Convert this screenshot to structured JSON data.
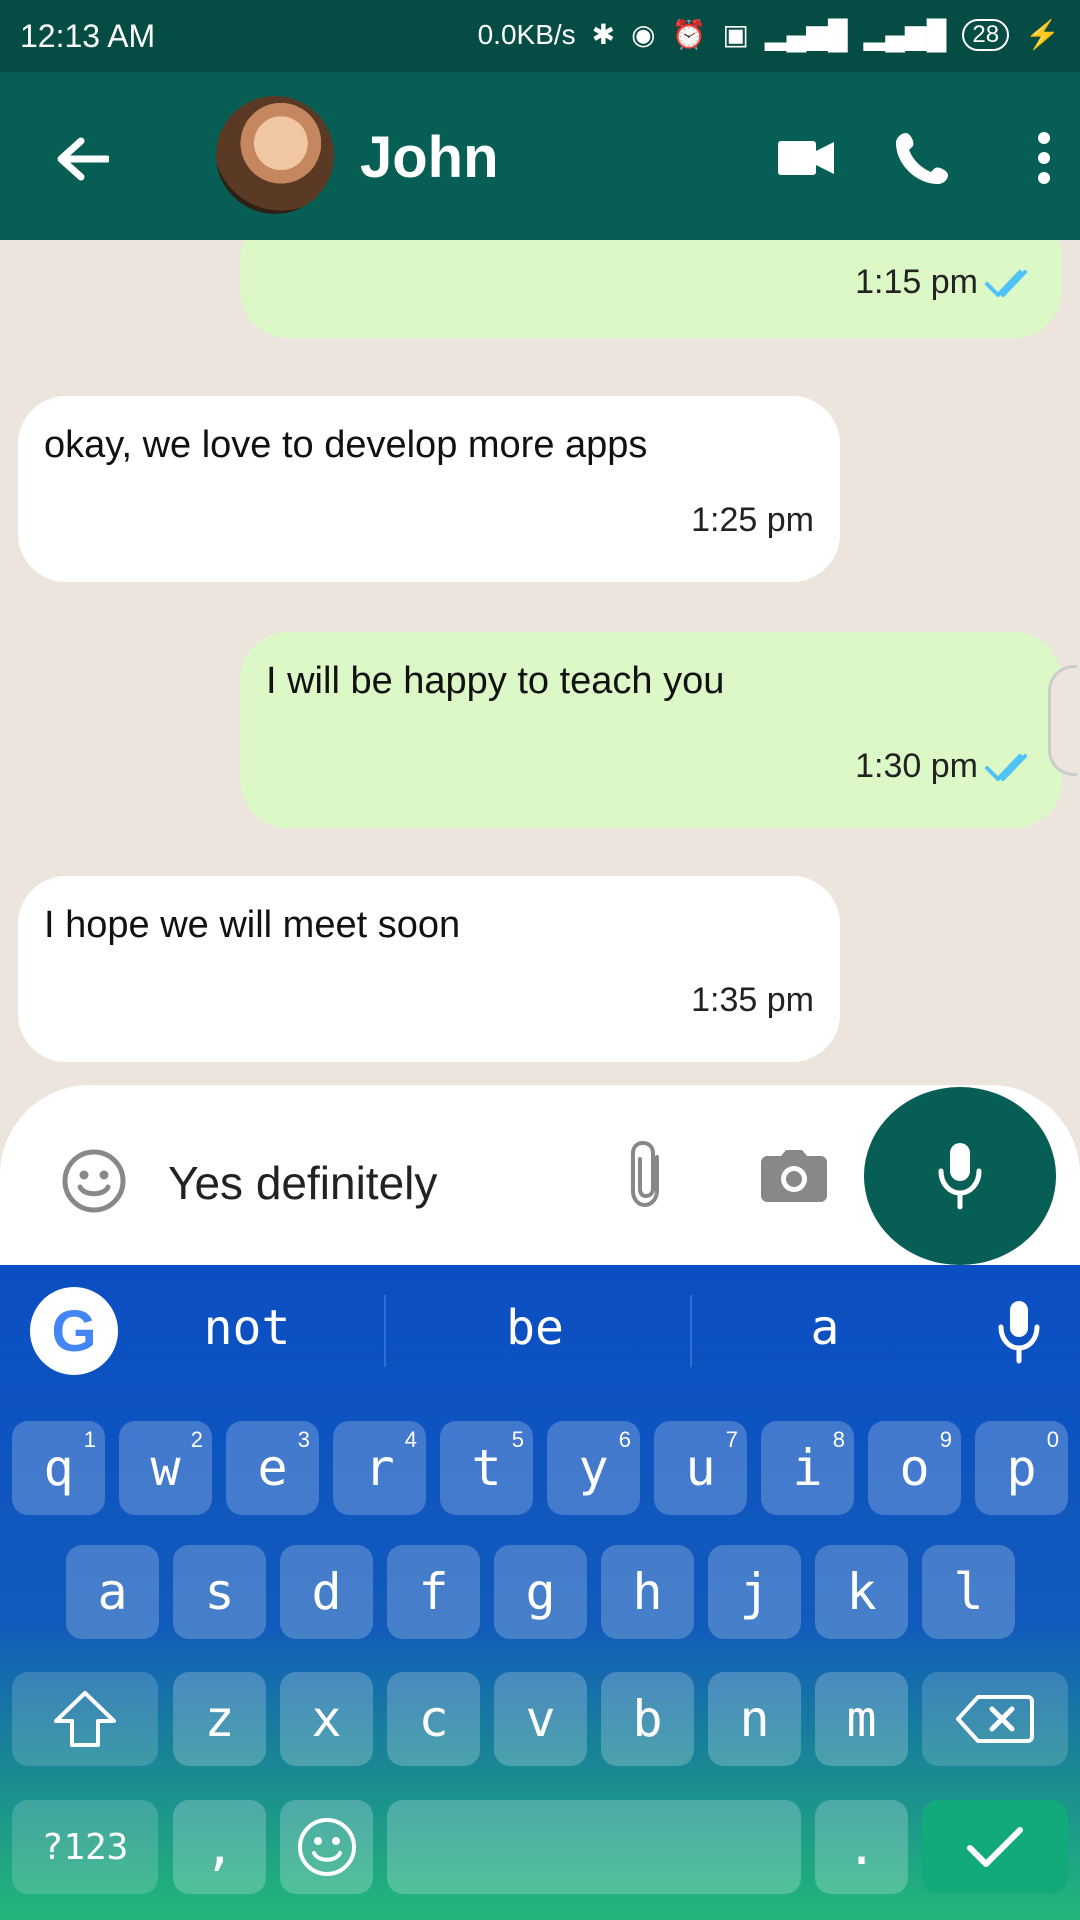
{
  "status_bar": {
    "time": "12:13 AM",
    "data_speed": "0.0KB/s",
    "battery": "28"
  },
  "header": {
    "contact_name": "John"
  },
  "messages": [
    {
      "direction": "outgoing",
      "text": "",
      "time": "1:15 pm"
    },
    {
      "direction": "incoming",
      "text": "okay, we love to develop more apps",
      "time": "1:25 pm"
    },
    {
      "direction": "outgoing",
      "text": "I will be happy to teach you",
      "time": "1:30 pm"
    },
    {
      "direction": "incoming",
      "text": "I hope we will meet soon",
      "time": "1:35 pm"
    }
  ],
  "composer": {
    "value": "Yes definitely"
  },
  "keyboard": {
    "suggestions": [
      "not",
      "be",
      "a"
    ],
    "row1": [
      {
        "key": "q",
        "num": "1"
      },
      {
        "key": "w",
        "num": "2"
      },
      {
        "key": "e",
        "num": "3"
      },
      {
        "key": "r",
        "num": "4"
      },
      {
        "key": "t",
        "num": "5"
      },
      {
        "key": "y",
        "num": "6"
      },
      {
        "key": "u",
        "num": "7"
      },
      {
        "key": "i",
        "num": "8"
      },
      {
        "key": "o",
        "num": "9"
      },
      {
        "key": "p",
        "num": "0"
      }
    ],
    "row2": [
      "a",
      "s",
      "d",
      "f",
      "g",
      "h",
      "j",
      "k",
      "l"
    ],
    "row3": [
      "z",
      "x",
      "c",
      "v",
      "b",
      "n",
      "m"
    ],
    "symbols_label": "?123",
    "comma": ",",
    "period": "."
  },
  "colors": {
    "header": "#075e54",
    "outgoing_bubble": "#dcf8c6",
    "incoming_bubble": "#ffffff",
    "chat_background": "#ece5dd",
    "read_ticks": "#4fc3f7"
  }
}
